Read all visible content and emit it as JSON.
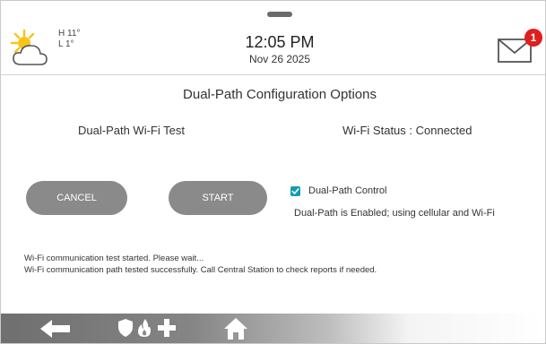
{
  "header": {
    "weather": {
      "icon": "partly-sunny-icon",
      "high": "H 11°",
      "low": "L 1°"
    },
    "time": "12:05 PM",
    "date": "Nov 26 2025",
    "messages": {
      "icon": "envelope-icon",
      "unread_count": "1"
    }
  },
  "main": {
    "title": "Dual-Path Configuration Options",
    "wifi_test_label": "Dual-Path Wi-Fi Test",
    "wifi_status": "Wi-Fi Status : Connected",
    "cancel_label": "CANCEL",
    "start_label": "START",
    "dual_path_control": {
      "label": "Dual-Path Control",
      "checked": true
    },
    "dual_path_status": "Dual-Path is Enabled; using cellular and Wi-Fi",
    "log": [
      "Wi-Fi communication test started. Please wait...",
      "Wi-Fi communication path tested successfully. Call Central Station to check reports if needed."
    ]
  },
  "navbar": {
    "icons": [
      "back-arrow-icon",
      "shield-icon",
      "fire-icon",
      "medical-cross-icon",
      "home-icon"
    ]
  },
  "colors": {
    "accent": "#169ab5",
    "badge": "#e01e1e",
    "button": "#8a8a8a"
  }
}
